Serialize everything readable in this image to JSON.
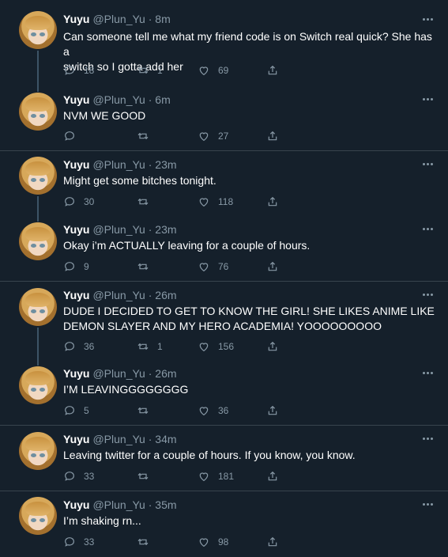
{
  "theme": {
    "background": "#15202b",
    "text": "#ffffff",
    "muted": "#8899a6",
    "divider": "#38444d",
    "thread": "#3d5466"
  },
  "tweets": [
    {
      "name": "Yuyu",
      "handle": "@Plun_Yu · 8m",
      "lines": [
        "Can someone tell me what my friend code is on Switch real quick? She has a",
        "switch so I gotta add her"
      ],
      "replies": "18",
      "retweets": "1",
      "likes": "69"
    },
    {
      "name": "Yuyu",
      "handle": "@Plun_Yu · 6m",
      "lines": [
        "NVM WE GOOD"
      ],
      "replies": "",
      "retweets": "",
      "likes": "27"
    },
    {
      "name": "Yuyu",
      "handle": "@Plun_Yu · 23m",
      "lines": [
        "Might get some bitches tonight."
      ],
      "replies": "30",
      "retweets": "",
      "likes": "118"
    },
    {
      "name": "Yuyu",
      "handle": "@Plun_Yu · 23m",
      "lines": [
        "Okay i’m ACTUALLY leaving for a couple of hours."
      ],
      "replies": "9",
      "retweets": "",
      "likes": "76"
    },
    {
      "name": "Yuyu",
      "handle": "@Plun_Yu · 26m",
      "lines": [
        "DUDE I DECIDED TO GET TO KNOW THE GIRL! SHE LIKES ANIME LIKE",
        "DEMON SLAYER AND MY HERO ACADEMIA! YOOOOOOOOO"
      ],
      "replies": "36",
      "retweets": "1",
      "likes": "156"
    },
    {
      "name": "Yuyu",
      "handle": "@Plun_Yu · 26m",
      "lines": [
        "I’M LEAVINGGGGGGGG"
      ],
      "replies": "5",
      "retweets": "",
      "likes": "36"
    },
    {
      "name": "Yuyu",
      "handle": "@Plun_Yu · 34m",
      "lines": [
        "Leaving twitter for a couple of hours. If you know, you know."
      ],
      "replies": "33",
      "retweets": "",
      "likes": "181"
    },
    {
      "name": "Yuyu",
      "handle": "@Plun_Yu · 35m",
      "lines": [
        "I’m shaking rn..."
      ],
      "replies": "33",
      "retweets": "",
      "likes": "98"
    }
  ]
}
